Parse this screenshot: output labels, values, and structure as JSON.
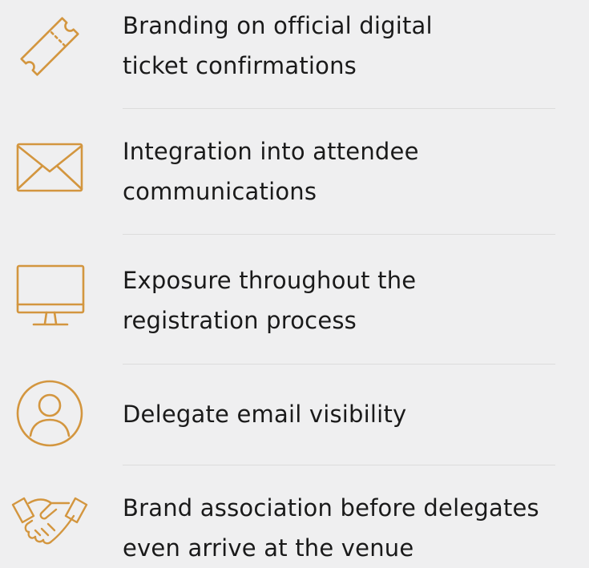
{
  "accent_color": "#d3963f",
  "features": [
    {
      "icon": "ticket-icon",
      "lines": [
        "Branding on official digital",
        "ticket confirmations"
      ]
    },
    {
      "icon": "envelope-icon",
      "lines": [
        "Integration into attendee",
        "communications"
      ]
    },
    {
      "icon": "monitor-icon",
      "lines": [
        "Exposure throughout the",
        "registration process"
      ]
    },
    {
      "icon": "user-circle-icon",
      "lines": [
        "Delegate email visibility"
      ]
    },
    {
      "icon": "handshake-icon",
      "lines": [
        "Brand association before delegates",
        "even arrive at the venue"
      ]
    }
  ]
}
